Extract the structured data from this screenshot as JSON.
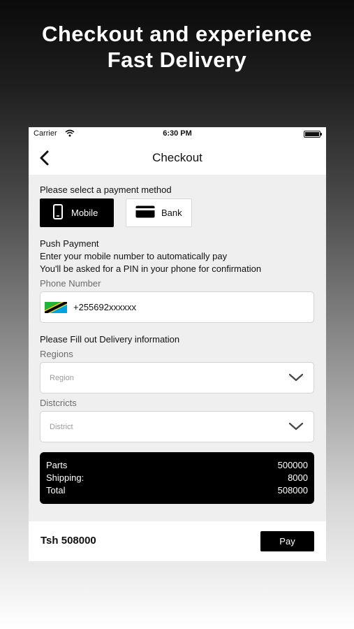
{
  "headline": {
    "line1": "Checkout and experience",
    "line2": "Fast Delivery"
  },
  "status_bar": {
    "carrier": "Carrier",
    "time": "6:30 PM"
  },
  "nav": {
    "title": "Checkout",
    "back_icon": "chevron-left-icon"
  },
  "payment": {
    "prompt": "Please select a payment method",
    "methods": [
      {
        "label": "Mobile",
        "icon": "mobile-phone-icon",
        "selected": true
      },
      {
        "label": "Bank",
        "icon": "bank-card-icon",
        "selected": false
      }
    ],
    "push_title": "Push Payment",
    "push_line1": "Enter your mobile number to automatically pay",
    "push_line2": "You'll be asked for a PIN in your phone for confirmation"
  },
  "phone": {
    "label": "Phone Number",
    "value": "+255692xxxxxx",
    "flag_icon": "tanzania-flag-icon"
  },
  "delivery": {
    "prompt": "Please Fill out Delivery information",
    "regions_label": "Regions",
    "region_placeholder": "Region",
    "districts_label": "Distcricts",
    "district_placeholder": "District"
  },
  "summary": {
    "rows": [
      {
        "label": "Parts",
        "value": "500000"
      },
      {
        "label": "Shipping:",
        "value": "8000"
      },
      {
        "label": "Total",
        "value": "508000"
      }
    ]
  },
  "footer": {
    "total": "Tsh 508000",
    "pay_label": "Pay"
  },
  "colors": {
    "accent": "#000000",
    "background": "#efeff0"
  }
}
